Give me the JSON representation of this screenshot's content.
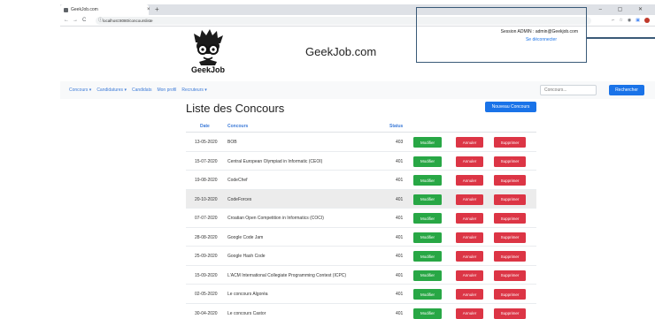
{
  "browser": {
    "tab_title": "GeekJob.com",
    "tab_close": "×",
    "new_tab": "+",
    "window_controls": "– ▢ ✕",
    "nav_back": "←",
    "nav_forward": "→",
    "nav_reload": "C",
    "url": "localhost:8080/concoursliste"
  },
  "header": {
    "logo_text": "GeekJob",
    "site_name": "GeekJob.com"
  },
  "session": {
    "text": "Session ADMIN : admin@Geekjob.com",
    "logout_label": "Se déconnecter"
  },
  "navbar": {
    "items": [
      "Concours ▾",
      "Candidatures ▾",
      "Candidats",
      "Mon profil",
      "Recruteurs ▾"
    ],
    "search_placeholder": "Concours...",
    "search_button": "Rechercher"
  },
  "main": {
    "title": "Liste des Concours",
    "new_button": "Nouveau Concours",
    "columns": {
      "date": "Date",
      "concours": "Concours",
      "status": "Status"
    },
    "button_labels": {
      "modify": "Modifier",
      "cancel": "Annuler",
      "delete": "Supprimer"
    },
    "rows": [
      {
        "date": "13-05-2020",
        "name": "BOB",
        "status": "403"
      },
      {
        "date": "15-07-2020",
        "name": "Central European Olympiad in Informatic (CEOI)",
        "status": "401"
      },
      {
        "date": "19-08-2020",
        "name": "CodeChef",
        "status": "401"
      },
      {
        "date": "20-10-2020",
        "name": "CodeForces",
        "status": "401"
      },
      {
        "date": "07-07-2020",
        "name": "Croatian Open Competition in Informatics (COCI)",
        "status": "401"
      },
      {
        "date": "28-08-2020",
        "name": "Google Code Jam",
        "status": "401"
      },
      {
        "date": "25-09-2020",
        "name": "Google Hash Code",
        "status": "401"
      },
      {
        "date": "15-09-2020",
        "name": "L'ACM International Collegiate Programming Contest (ICPC)",
        "status": "401"
      },
      {
        "date": "02-05-2020",
        "name": "Le concours Algoréa",
        "status": "401"
      },
      {
        "date": "30-04-2020",
        "name": "Le concours Castor",
        "status": "401"
      }
    ]
  },
  "colors": {
    "primary": "#1a73e8",
    "success": "#28a745",
    "danger": "#dc3545",
    "session_border": "#3a5a78"
  }
}
